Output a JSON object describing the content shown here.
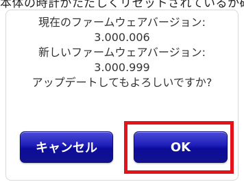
{
  "background_text": "本体の時計がただしくリセットされているか確認してください。",
  "dialog": {
    "message_lines": [
      "現在のファームウェアバージョン:",
      "3.000.006",
      "新しいファームウェアバージョン:",
      "3.000.999",
      "アップデートしてもよろしいですか?"
    ],
    "cancel_label": "キャンセル",
    "ok_label": "OK"
  },
  "colors": {
    "button_blue": "#1d1db8",
    "highlight_red": "#e3121c"
  }
}
